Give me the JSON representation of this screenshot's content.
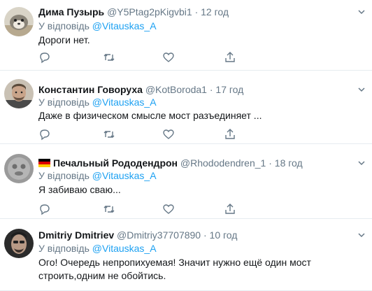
{
  "tweets": [
    {
      "name": "Дима Пузырь",
      "handle": "@Y5Ptag2pKigvbi1",
      "dot": "·",
      "time": "12 год",
      "reply_prefix": "У відповідь",
      "reply_to": "@Vitauskas_A",
      "text": "Дороги нет.",
      "has_flag": false
    },
    {
      "name": "Константин Говоруха",
      "handle": "@KotBoroda1",
      "dot": "·",
      "time": "17 год",
      "reply_prefix": "У відповідь",
      "reply_to": "@Vitauskas_A",
      "text": "Даже в физическом смысле мост разъединяет ...",
      "has_flag": false
    },
    {
      "name": "Печальный Рододендрон",
      "handle": "@Rhododendren_1",
      "dot": "·",
      "time": "18 год",
      "reply_prefix": "У відповідь",
      "reply_to": "@Vitauskas_A",
      "text": "Я забиваю сваю...",
      "has_flag": true
    },
    {
      "name": "Dmitriy Dmitriev",
      "handle": "@Dmitriy37707890",
      "dot": "·",
      "time": "10 год",
      "reply_prefix": "У відповідь",
      "reply_to": "@Vitauskas_A",
      "text": "Ого! Очередь непропихуемая! Значит нужно ещё один мост строить,одним не обойтись.",
      "has_flag": false
    }
  ],
  "colors": {
    "accent": "#1da1f2",
    "secondary_text": "#657786",
    "divider": "#e6ecf0"
  },
  "icons": [
    "reply-icon",
    "retweet-icon",
    "like-icon",
    "share-icon",
    "chevron-down-icon",
    "germany-flag-icon"
  ]
}
